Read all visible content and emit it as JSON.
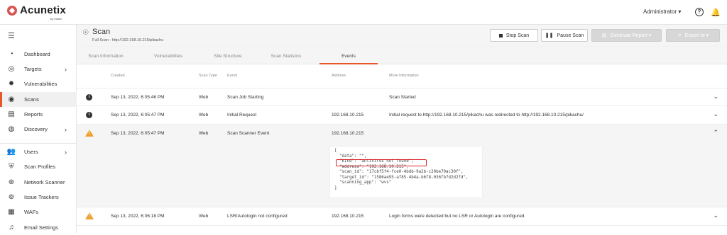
{
  "app": {
    "name": "Acunetix",
    "sub": "by Invicti"
  },
  "topbar": {
    "user": "Administrator ▾",
    "help": "?"
  },
  "sidebar": {
    "items": [
      {
        "label": "Dashboard",
        "icon": "◔",
        "chev": ""
      },
      {
        "label": "Targets",
        "icon": "◎",
        "chev": "›"
      },
      {
        "label": "Vulnerabilities",
        "icon": "✹",
        "chev": ""
      },
      {
        "label": "Scans",
        "icon": "◉",
        "chev": ""
      },
      {
        "label": "Reports",
        "icon": "▤",
        "chev": ""
      },
      {
        "label": "Discovery",
        "icon": "◍",
        "chev": "›"
      },
      {
        "label": "Users",
        "icon": "👥",
        "chev": "›"
      },
      {
        "label": "Scan Profiles",
        "icon": "⛨",
        "chev": ""
      },
      {
        "label": "Network Scanner",
        "icon": "⊛",
        "chev": ""
      },
      {
        "label": "Issue Trackers",
        "icon": "⊚",
        "chev": ""
      },
      {
        "label": "WAFs",
        "icon": "▦",
        "chev": ""
      },
      {
        "label": "Email Settings",
        "icon": "♫",
        "chev": ""
      }
    ]
  },
  "header": {
    "title": "Scan",
    "subtitle": "Full Scan - http://192.168.10.215/pikachu",
    "stop_label": "Stop Scan",
    "pause_label": "Pause Scan",
    "report_label": "Generate Report ▾",
    "export_label": "Export to ▾"
  },
  "tabs": [
    "Scan Information",
    "Vulnerabilities",
    "Site Structure",
    "Scan Statistics",
    "Events"
  ],
  "table": {
    "headers": [
      "Created",
      "Scan Type",
      "Event",
      "Address",
      "More Information"
    ],
    "rows": [
      {
        "type": "info",
        "created": "Sep 13, 2022, 6:05:46 PM",
        "scan_type": "Web",
        "event": "Scan Job Starting",
        "address": "",
        "info": "Scan Started"
      },
      {
        "type": "info",
        "created": "Sep 13, 2022, 6:05:47 PM",
        "scan_type": "Web",
        "event": "Initial Request",
        "address": "192.168.10.215",
        "info": "Initial request to http://192.168.10.215/pikachu was redirected to http://192.168.10.215/pikachu/"
      },
      {
        "type": "warn",
        "created": "Sep 13, 2022, 6:05:47 PM",
        "scan_type": "Web",
        "event": "Scan Scanner Event",
        "address": "192.168.10.215",
        "info": ""
      },
      {
        "type": "warn",
        "created": "Sep 13, 2022, 6:06:18 PM",
        "scan_type": "Web",
        "event": "LSR/Autologin not configured",
        "address": "192.168.10.215",
        "info": "Login forms were detected but no LSR or Autologin are configured."
      }
    ],
    "json_lines": [
      "[",
      "  \"data\": \"\",",
      "  \"kind\": \"antivirus_not_found\",",
      "  \"address\": \"192.168.10.215\",",
      "  \"scan_id\": \"17cbf5f4-fce0-4bdb-9a2b-c20be70ac30f\",",
      "  \"target_id\": \"1586ae95-af85-4b4a-b6f8-036fb7d2d2fd\",",
      "  \"scanning_app\": \"wvs\"",
      "]"
    ]
  },
  "colors": {
    "accent": "#e8562a",
    "warn": "#f0a030",
    "highlight": "#d9252a"
  }
}
